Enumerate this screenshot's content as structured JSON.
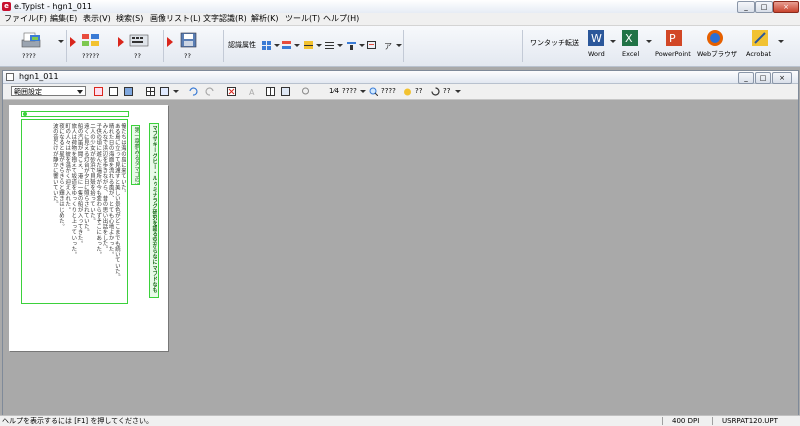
{
  "window": {
    "title": "e.Typist - hgn1_011",
    "min": "_",
    "max": "□",
    "close": "×"
  },
  "menu": [
    "ファイル(F)",
    "編集(E)",
    "表示(V)",
    "検索(S)",
    "画像リスト(L)",
    "文字認識(R)",
    "解析(K)",
    "ツール(T)",
    "ヘルプ(H)"
  ],
  "ribbon": {
    "btn1_label": "????",
    "btn2_label": "?????",
    "btn3_label": "??",
    "btn4_label": "??",
    "recog_attr": "認識属性",
    "onetouch": "ワンタッチ転送",
    "word": "Word",
    "excel": "Excel",
    "powerpoint": "PowerPoint",
    "browser": "Webブラウザ",
    "acrobat": "Acrobat"
  },
  "doc": {
    "title": "hgn1_011",
    "range_select": "範囲設定",
    "zoom_label": "1⁄4",
    "tool_a": "????",
    "tool_b": "????",
    "tool_c": "??",
    "tool_d": "??"
  },
  "page_text": {
    "col_headline": "マブザキーグピー・ルゥミナラグ研究を語る空からなにマブドなも",
    "col_sub": "第一章夢みるタマゴの話…平成27年",
    "body": [
      "俺たちは海の島に来ていた。",
      "ある島に立って見渡すと美しい景色がどこまでも続いていた。",
      "晴れた日の海面を流れる風が、とても心地よかった。",
      "みんなで浜辺を歩きながら、昔の思い出話をした。",
      "子供の頃に遊んだ場所が今も変わらずそこにあった。",
      "二人の少女が砂浜で貝殻を拾っていた。",
      "遠くに見える灯台が夕日に照らされていた。",
      "船の汽笛が聞こえ、港に一隻の船が入ってきた。",
      "旅人は荷物を抱えて坂道をゆっくりと上っていった。",
      "町の人々は彼を温かく迎え入れた。",
      "夜になると星がきらきらと輝きはじめた。",
      "波の音だけが静かに響いていた。"
    ]
  },
  "status": {
    "help": "ヘルプを表示するには [F1] を押してください。",
    "dpi": "400 DPI",
    "file": "USRPAT120.UPT"
  },
  "colors": {
    "accent_red": "#d9261c",
    "ocr_green": "#3bd13b",
    "workspace": "#a9a9a9"
  }
}
